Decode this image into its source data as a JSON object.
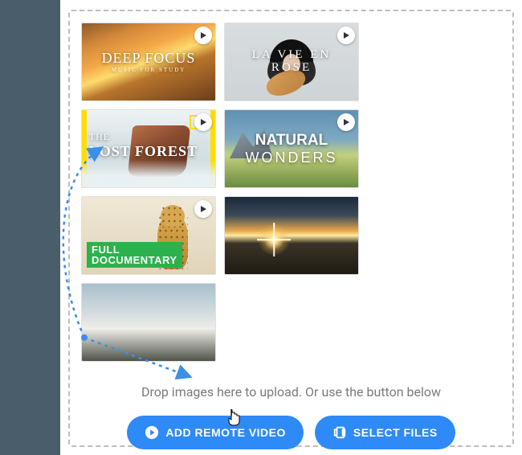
{
  "thumbnails": [
    {
      "title": "DEEP FOCUS",
      "subtitle": "MUSIC FOR STUDY",
      "is_video": true,
      "kind": "autumn"
    },
    {
      "title": "LA VIE EN ROSE",
      "subtitle": "",
      "is_video": true,
      "kind": "vie"
    },
    {
      "title_pre": "THE",
      "title": "LOST FOREST",
      "is_video": true,
      "kind": "forest",
      "natgeo": true
    },
    {
      "title_pre": "NATURAL",
      "title": "WONDERS",
      "is_video": true,
      "kind": "natural"
    },
    {
      "title": "",
      "banner": "FULL\nDOCUMENTARY",
      "is_video": true,
      "kind": "documentary"
    },
    {
      "title": "",
      "is_video": false,
      "kind": "sunrise"
    },
    {
      "title": "",
      "is_video": false,
      "kind": "clouds"
    }
  ],
  "hint_text": "Drop images here to upload. Or use the button below",
  "buttons": {
    "add_remote_video": "ADD REMOTE VIDEO",
    "select_files": "SELECT FILES"
  },
  "colors": {
    "accent": "#2e8af7",
    "sidebar": "#4a5d6b"
  }
}
